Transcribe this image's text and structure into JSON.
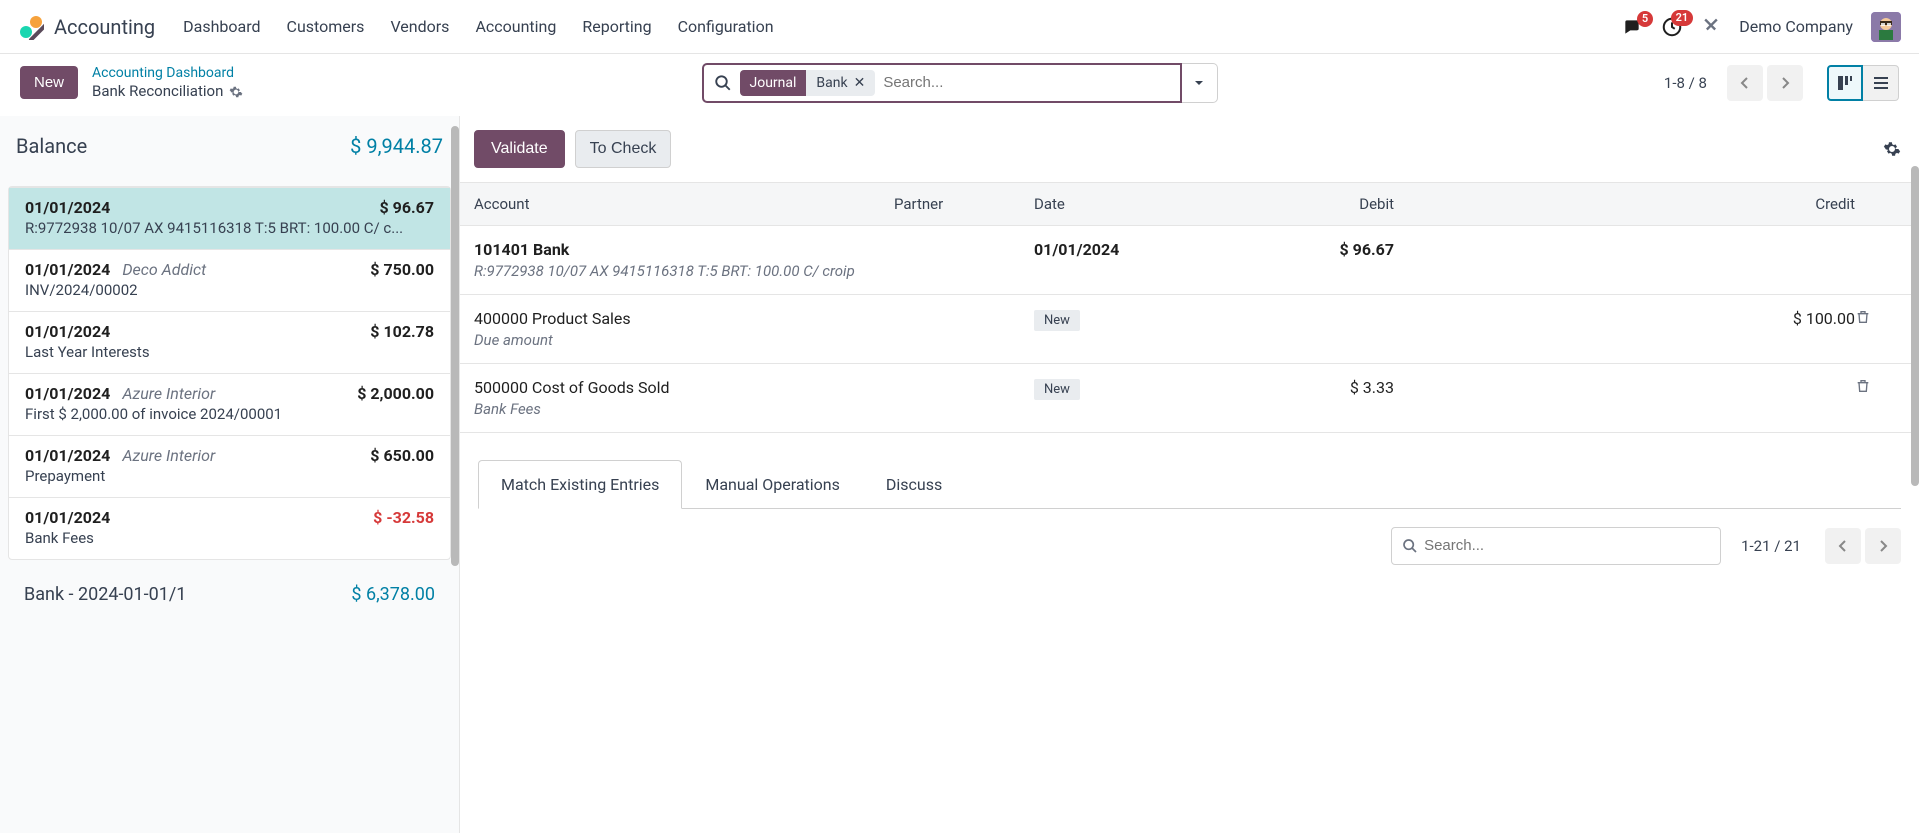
{
  "header": {
    "app_name": "Accounting",
    "nav": [
      "Dashboard",
      "Customers",
      "Vendors",
      "Accounting",
      "Reporting",
      "Configuration"
    ],
    "messages_badge": "5",
    "activities_badge": "21",
    "company": "Demo Company"
  },
  "actionbar": {
    "new_label": "New",
    "breadcrumb_parent": "Accounting Dashboard",
    "breadcrumb_current": "Bank Reconciliation",
    "search_tag_field": "Journal",
    "search_tag_value": "Bank",
    "search_placeholder": "Search...",
    "pager": "1-8 / 8"
  },
  "left": {
    "balance_label": "Balance",
    "balance_amount": "$ 9,944.87",
    "transactions": [
      {
        "date": "01/01/2024",
        "partner": "",
        "amount": "$ 96.67",
        "neg": false,
        "desc": "R:9772938 10/07 AX 9415116318 T:5 BRT: 100.00 C/ c...",
        "selected": true
      },
      {
        "date": "01/01/2024",
        "partner": "Deco Addict",
        "amount": "$ 750.00",
        "neg": false,
        "desc": "INV/2024/00002",
        "selected": false
      },
      {
        "date": "01/01/2024",
        "partner": "",
        "amount": "$ 102.78",
        "neg": false,
        "desc": "Last Year Interests",
        "selected": false
      },
      {
        "date": "01/01/2024",
        "partner": "Azure Interior",
        "amount": "$ 2,000.00",
        "neg": false,
        "desc": "First $ 2,000.00 of invoice 2024/00001",
        "selected": false
      },
      {
        "date": "01/01/2024",
        "partner": "Azure Interior",
        "amount": "$ 650.00",
        "neg": false,
        "desc": "Prepayment",
        "selected": false
      },
      {
        "date": "01/01/2024",
        "partner": "",
        "amount": "$ -32.58",
        "neg": true,
        "desc": "Bank Fees",
        "selected": false
      }
    ],
    "footer_ref": "Bank - 2024-01-01/1",
    "footer_amt": "$ 6,378.00"
  },
  "right": {
    "validate_label": "Validate",
    "tocheck_label": "To Check",
    "columns": {
      "account": "Account",
      "partner": "Partner",
      "date": "Date",
      "debit": "Debit",
      "credit": "Credit"
    },
    "rows": [
      {
        "account": "101401 Bank",
        "desc": "R:9772938 10/07 AX 9415116318 T:5 BRT: 100.00 C/ croip",
        "partner": "",
        "date": "01/01/2024",
        "date_bold": true,
        "debit": "$ 96.67",
        "credit": "",
        "is_new": false,
        "bold": true,
        "trash": false
      },
      {
        "account": "400000 Product Sales",
        "desc": "Due amount",
        "partner": "",
        "date": "",
        "date_bold": false,
        "debit": "",
        "credit": "$ 100.00",
        "is_new": true,
        "bold": false,
        "trash": true
      },
      {
        "account": "500000 Cost of Goods Sold",
        "desc": "Bank Fees",
        "partner": "",
        "date": "",
        "date_bold": false,
        "debit": "$ 3.33",
        "credit": "",
        "is_new": true,
        "bold": false,
        "trash": true
      }
    ],
    "new_badge": "New",
    "tabs": [
      "Match Existing Entries",
      "Manual Operations",
      "Discuss"
    ],
    "active_tab": 0,
    "mini_search_placeholder": "Search...",
    "mini_pager": "1-21 / 21"
  }
}
